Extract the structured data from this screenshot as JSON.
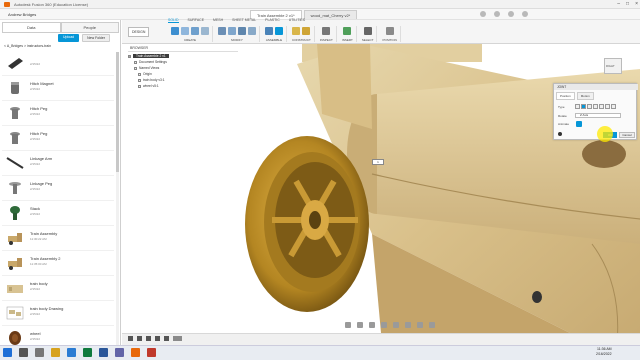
{
  "window": {
    "title": "Autodesk Fusion 360 (Education License)"
  },
  "topbar": {
    "user": "Andrew Bridges",
    "doc_tabs": [
      "Train Assemble 2 v1*",
      "wood_mat_Cherry v2*"
    ]
  },
  "data_panel": {
    "tabs": [
      "Data",
      "People"
    ],
    "upload_label": "Upload",
    "new_folder_label": "New Folder",
    "breadcrumb": "< A_Bridges > instructors-train",
    "files": [
      {
        "name": "",
        "date": "2/15/22",
        "thumb": "dark-wedge"
      },
      {
        "name": "Hitch Magnet",
        "date": "2/15/22",
        "thumb": "gray-magnet"
      },
      {
        "name": "Hitch Peg",
        "date": "2/15/22",
        "thumb": "gray-peg"
      },
      {
        "name": "Hitch Peg",
        "date": "2/15/22",
        "thumb": "gray-peg"
      },
      {
        "name": "Linkage Arm",
        "date": "2/15/22",
        "thumb": "dark-rod"
      },
      {
        "name": "Linkage Peg",
        "date": "2/15/22",
        "thumb": "gray-peg"
      },
      {
        "name": "Stack",
        "date": "2/15/22",
        "thumb": "green-stack"
      },
      {
        "name": "Train Assembly",
        "date": "11:30:22 AM",
        "thumb": "wood-train"
      },
      {
        "name": "Train Assembly 2",
        "date": "11:35:00 AM",
        "thumb": "wood-train"
      },
      {
        "name": "train body",
        "date": "2/15/22",
        "thumb": "wood-body"
      },
      {
        "name": "train body Drawing",
        "date": "2/15/22",
        "thumb": "drawing"
      },
      {
        "name": "wheel",
        "date": "2/15/22",
        "thumb": "wheel"
      }
    ]
  },
  "toolbar": {
    "workspace": "DESIGN",
    "ribbon_tabs": [
      "SOLID",
      "SURFACE",
      "MESH",
      "SHEET METAL",
      "PLASTIC",
      "UTILITIES"
    ],
    "active_tab": "SOLID",
    "groups": [
      "CREATE",
      "MODIFY",
      "ASSEMBLE",
      "CONSTRUCT",
      "INSPECT",
      "INSERT",
      "SELECT",
      "POSITION"
    ]
  },
  "browser": {
    "title": "BROWSER",
    "root": "Train Assemble 2 v1",
    "nodes": [
      "Document Settings",
      "Named Views",
      "Origin",
      "train body v3:1",
      "wheel v5:1"
    ]
  },
  "viewcube": {
    "label": "RIGHT"
  },
  "joint_dialog": {
    "title": "JOINT",
    "tabs": [
      "Position",
      "Motion"
    ],
    "type_label": "Type",
    "rotate_label": "Rotate",
    "rotate_value": "Z Axis",
    "animate_label": "Animate",
    "ok_label": "OK",
    "cancel_label": "Cancel"
  },
  "anchor_label": "1",
  "taskbar": {
    "time": "11:36 AM",
    "date": "2/16/2022"
  },
  "colors": {
    "accent": "#0696d7",
    "wood": "#d8c393",
    "brass": "#b48622",
    "orange": "#e8690b"
  }
}
